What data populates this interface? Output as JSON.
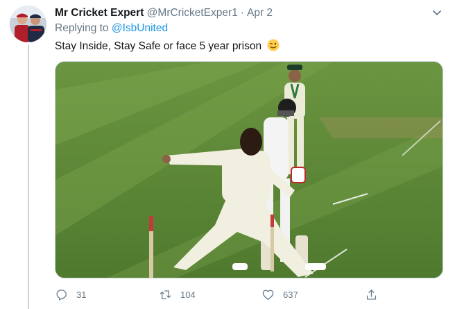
{
  "tweet": {
    "display_name": "Mr Cricket Expert",
    "handle": "@MrCricketExper1",
    "separator": "·",
    "date": "Apr 2",
    "replying_to_prefix": "Replying to",
    "replying_to_handle": "@IsbUnited",
    "text": "Stay Inside, Stay Safe or face 5 year prison",
    "emoji": "winking-face"
  },
  "actions": {
    "replies": "31",
    "retweets": "104",
    "likes": "637"
  },
  "icons": {
    "caret": "chevron-down-icon",
    "reply": "reply-icon",
    "retweet": "retweet-icon",
    "like": "heart-icon",
    "share": "share-icon"
  },
  "colors": {
    "text": "#14171a",
    "secondary": "#657786",
    "link": "#1b95e0",
    "thread_line": "#ccd6dd",
    "pitch_green": "#5f8a3a"
  }
}
